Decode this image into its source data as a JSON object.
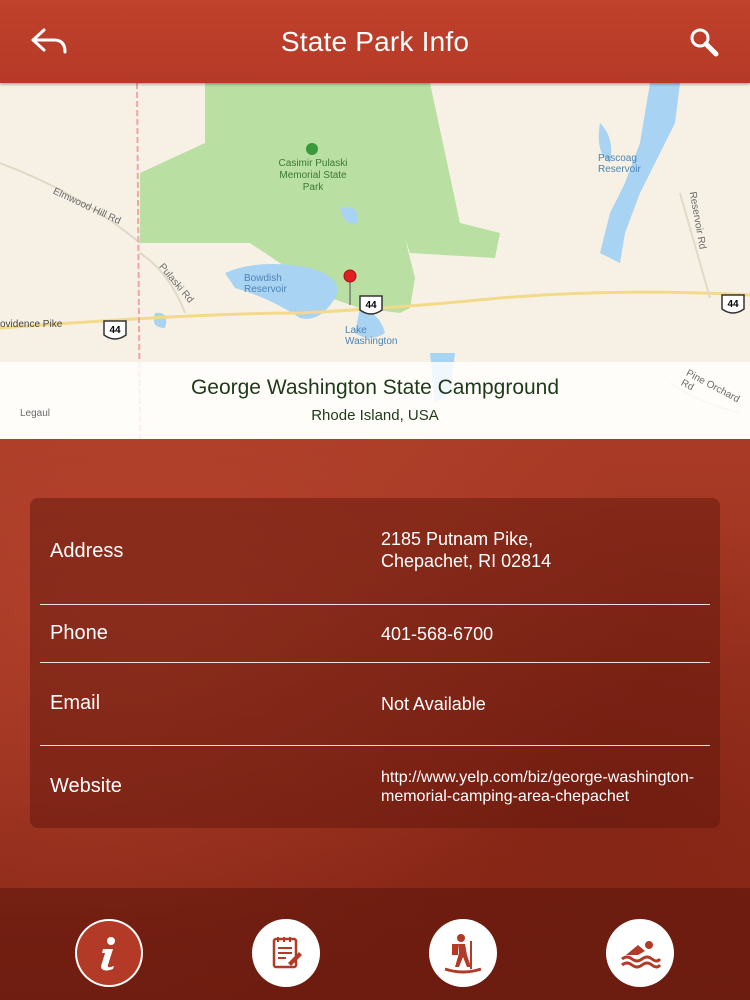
{
  "header": {
    "title": "State Park Info"
  },
  "map": {
    "labels": {
      "park": "Casimir Pulaski Memorial State Park",
      "bowdish": "Bowdish Reservoir",
      "pascoag": "Pascoag Reservoir",
      "lake_washington": "Lake Washington",
      "elmwood": "Elmwood Hill Rd",
      "pulaski": "Pulaski Rd",
      "providence": "ovidence Pike",
      "reservoir_rd": "Reservoir Rd",
      "pine_orchard": "Pine Orchard Rd",
      "legaul": "Legaul",
      "route": "44"
    }
  },
  "place": {
    "name": "George Washington State Campground",
    "region": "Rhode Island, USA"
  },
  "info": {
    "address_label": "Address",
    "address_line1": "2185 Putnam Pike,",
    "address_line2": "Chepachet, RI 02814",
    "phone_label": "Phone",
    "phone_value": "401-568-6700",
    "email_label": "Email",
    "email_value": "Not Available",
    "website_label": "Website",
    "website_line1": "http://www.yelp.com/biz/george-washington-",
    "website_line2": "memorial-camping-area-chepachet"
  },
  "colors": {
    "header": "#c0412c",
    "accent": "#b33a26",
    "pin": "#e02020"
  }
}
